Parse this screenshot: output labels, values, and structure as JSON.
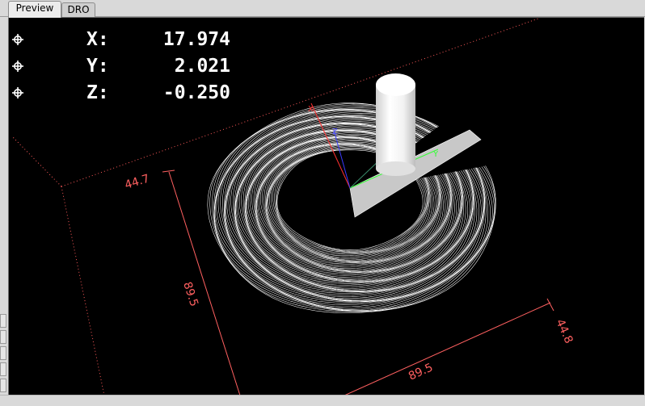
{
  "tabs": [
    {
      "label": "Preview",
      "active": true
    },
    {
      "label": "DRO",
      "active": false
    }
  ],
  "dro": {
    "x_label": "X:",
    "x_value": "17.974",
    "y_label": "Y:",
    "y_value": "2.021",
    "z_label": "Z:",
    "z_value": "-0.250"
  },
  "dimensions": {
    "top_left": "44.7",
    "left_side": "89.5",
    "bottom_side": "89.5",
    "right_side": "44.8"
  },
  "axis_labels": {
    "x": "X",
    "y": "Y",
    "z": "Z"
  },
  "colors": {
    "background": "#000000",
    "toolpath": "#ffffff",
    "extents": "#ff5a5a",
    "axis_x": "#ff3030",
    "axis_y": "#33ff33",
    "axis_z": "#3a3aff"
  }
}
